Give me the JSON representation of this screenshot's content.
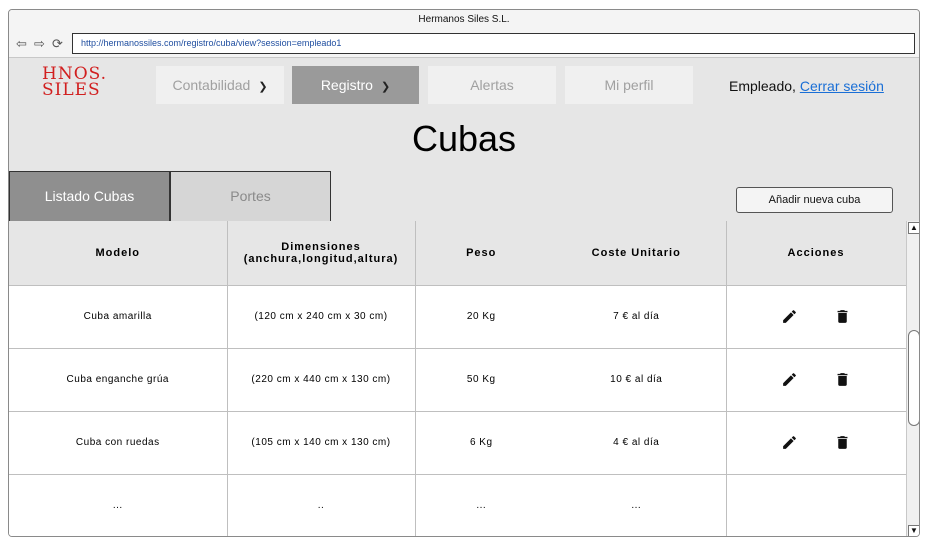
{
  "window": {
    "title": "Hermanos Siles S.L.",
    "url": "http://hermanossiles.com/registro/cuba/view?session=empleado1"
  },
  "header": {
    "logo_line1": "HNOS.",
    "logo_line2": "SILES",
    "nav": [
      {
        "label": "Contabilidad",
        "has_dropdown": true,
        "active": false
      },
      {
        "label": "Registro",
        "has_dropdown": true,
        "active": true
      },
      {
        "label": "Alertas",
        "has_dropdown": false,
        "active": false
      },
      {
        "label": "Mi perfil",
        "has_dropdown": false,
        "active": false
      }
    ],
    "session_user": "Empleado,",
    "logout_label": "Cerrar sesión"
  },
  "page": {
    "title": "Cubas",
    "tabs": [
      {
        "label": "Listado Cubas",
        "active": true
      },
      {
        "label": "Portes",
        "active": false
      }
    ],
    "add_button": "Añadir nueva cuba"
  },
  "table": {
    "headers": {
      "modelo": "Modelo",
      "dimensiones_1": "Dimensiones",
      "dimensiones_2": "(anchura,longitud,altura)",
      "peso": "Peso",
      "coste": "Coste Unitario",
      "acciones": "Acciones"
    },
    "rows": [
      {
        "modelo": "Cuba amarilla",
        "dimensiones": "(120 cm x 240 cm x 30 cm)",
        "peso": "20 Kg",
        "coste": "7 € al día"
      },
      {
        "modelo": "Cuba enganche grúa",
        "dimensiones": "(220 cm x 440 cm x 130 cm)",
        "peso": "50 Kg",
        "coste": "10 € al día"
      },
      {
        "modelo": "Cuba con ruedas",
        "dimensiones": "(105 cm x 140 cm x 130 cm)",
        "peso": "6 Kg",
        "coste": "4 € al día"
      }
    ],
    "ellipsis_row": {
      "modelo": "...",
      "dimensiones": "..",
      "peso": "...",
      "coste": "..."
    }
  },
  "icons": {
    "edit": "pencil-icon",
    "delete": "trash-icon"
  },
  "colors": {
    "logo": "#d11f1f",
    "link": "#1a6fd6",
    "active_nav": "#9a9a9a",
    "active_tab": "#8f8f8f"
  }
}
